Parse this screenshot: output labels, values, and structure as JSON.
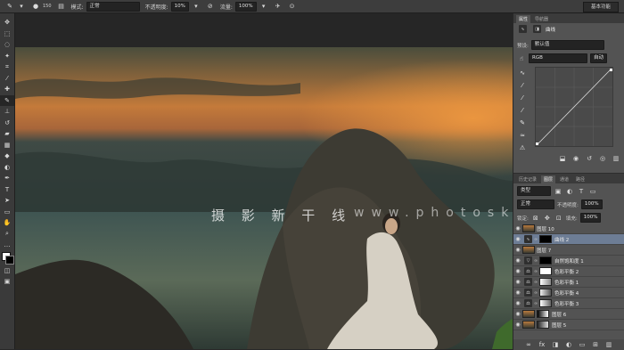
{
  "options_bar": {
    "brush_size": "150",
    "mode_label": "模式:",
    "mode_value": "正常",
    "opacity_label": "不透明度:",
    "opacity_value": "10%",
    "flow_label": "流量:",
    "flow_value": "100%",
    "workspace": "基本功能"
  },
  "toolbar": {
    "tools": [
      "move-icon",
      "marquee-icon",
      "lasso-icon",
      "magic-wand-icon",
      "crop-icon",
      "eyedropper-icon",
      "healing-icon",
      "brush-icon",
      "clone-stamp-icon",
      "history-brush-icon",
      "eraser-icon",
      "gradient-icon",
      "blur-icon",
      "dodge-icon",
      "pen-icon",
      "type-icon",
      "path-select-icon",
      "shape-icon",
      "hand-icon",
      "zoom-icon"
    ]
  },
  "canvas": {
    "watermark": "摄 影 新 干 线",
    "watermark_url": "www.photoskz.vip"
  },
  "properties_panel": {
    "tabs": [
      "属性",
      "导航器"
    ],
    "title": "曲线",
    "preset_label": "预设:",
    "preset_value": "默认值",
    "channel_value": "RGB",
    "auto_button": "自动"
  },
  "layers_panel": {
    "tabs": [
      "历史记录",
      "图层",
      "通道",
      "路径"
    ],
    "kind_label": "类型",
    "blend_mode": "正常",
    "opacity_label": "不透明度:",
    "opacity_value": "100%",
    "lock_label": "锁定:",
    "fill_label": "填充:",
    "fill_value": "100%",
    "layers": [
      {
        "name": "图层 10",
        "type": "pixel",
        "selected": false
      },
      {
        "name": "曲线 2",
        "type": "curves",
        "selected": true
      },
      {
        "name": "图层 7",
        "type": "pixel",
        "selected": false
      },
      {
        "name": "自然饱和度 1",
        "type": "vibrance",
        "selected": false
      },
      {
        "name": "色彩平衡 2",
        "type": "balance",
        "selected": false
      },
      {
        "name": "色彩平衡 1",
        "type": "balance",
        "selected": false
      },
      {
        "name": "色彩平衡 4",
        "type": "balance",
        "selected": false
      },
      {
        "name": "色彩平衡 3",
        "type": "balance",
        "selected": false
      },
      {
        "name": "图层 6",
        "type": "pixel",
        "selected": false
      },
      {
        "name": "图层 5",
        "type": "pixel",
        "selected": false
      }
    ]
  }
}
